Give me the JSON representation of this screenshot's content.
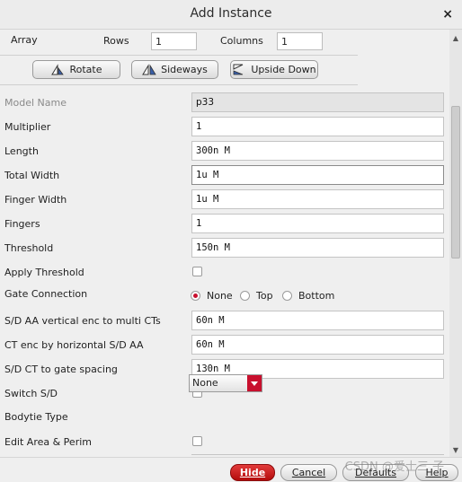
{
  "dialog": {
    "title": "Add Instance",
    "close_glyph": "×"
  },
  "array": {
    "label": "Array",
    "rows_label": "Rows",
    "rows_value": "1",
    "columns_label": "Columns",
    "columns_value": "1"
  },
  "transform_buttons": [
    {
      "label": "Rotate",
      "icon": "rotate-icon"
    },
    {
      "label": "Sideways",
      "icon": "sideways-icon"
    },
    {
      "label": "Upside Down",
      "icon": "upside-down-icon"
    }
  ],
  "form": {
    "model_name": {
      "label": "Model Name",
      "value": "p33"
    },
    "multiplier": {
      "label": "Multiplier",
      "value": "1"
    },
    "length": {
      "label": "Length",
      "value": "300n M"
    },
    "total_width": {
      "label": "Total Width",
      "value": "1u M"
    },
    "finger_width": {
      "label": "Finger Width",
      "value": "1u M"
    },
    "fingers": {
      "label": "Fingers",
      "value": "1"
    },
    "threshold": {
      "label": "Threshold",
      "value": "150n M"
    },
    "apply_threshold": {
      "label": "Apply Threshold",
      "checked": false
    },
    "gate_connection": {
      "label": "Gate Connection",
      "options": [
        "None",
        "Top",
        "Bottom"
      ],
      "selected": "None"
    },
    "sd_aa_vertical": {
      "label": "S/D AA vertical enc to multi CTs",
      "value": "60n M"
    },
    "ct_enc": {
      "label": "CT enc by horizontal S/D AA",
      "value": "60n M"
    },
    "sd_ct_gate": {
      "label": "S/D CT to gate spacing",
      "value": "130n M"
    },
    "switch_sd": {
      "label": "Switch S/D",
      "checked": false
    },
    "bodytie_type": {
      "label": "Bodytie Type",
      "value": "None"
    },
    "edit_area": {
      "label": "Edit Area & Perim",
      "checked": false
    }
  },
  "footer": {
    "hide": "Hide",
    "cancel": "Cancel",
    "defaults": "Defaults",
    "help": "Help"
  },
  "watermark": "CSDN @爱士三 子",
  "colors": {
    "accent": "#c8102e",
    "background": "#efefef"
  }
}
